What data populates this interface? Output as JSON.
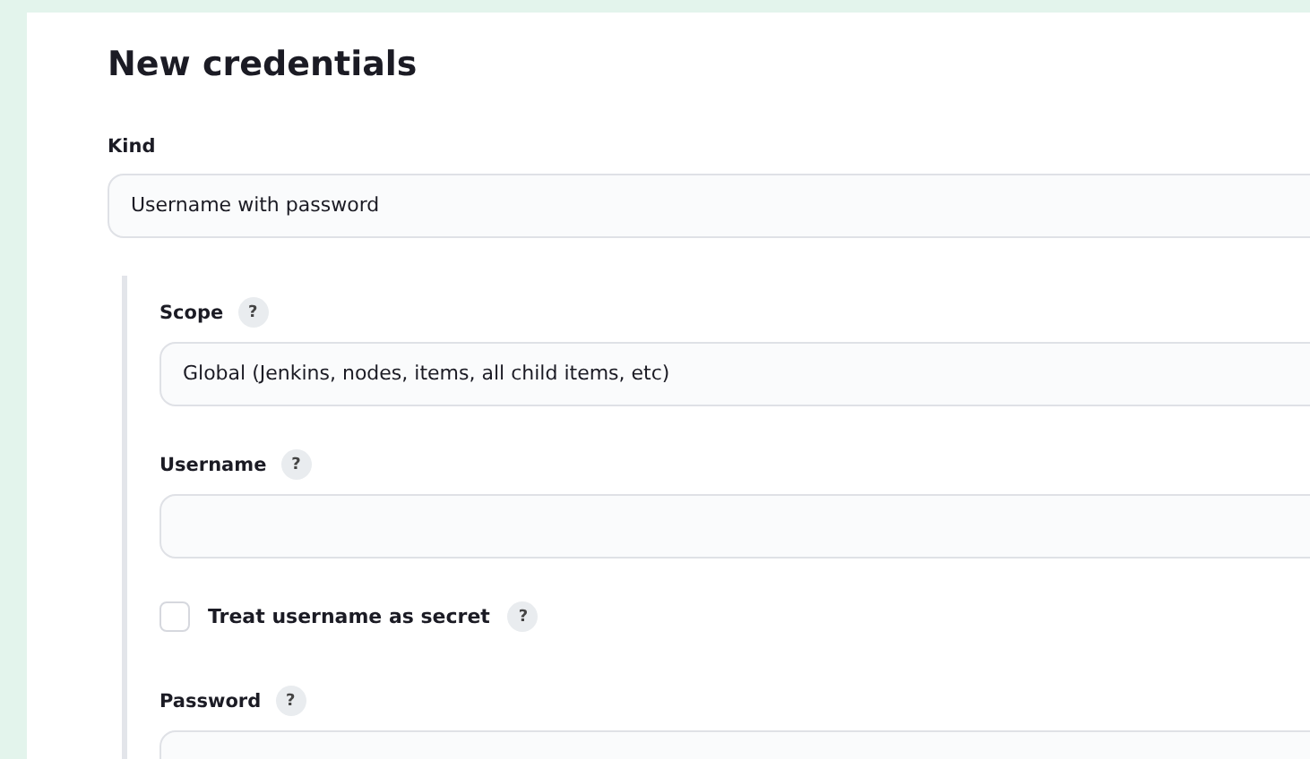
{
  "title": "New credentials",
  "kind": {
    "label": "Kind",
    "value": "Username with password"
  },
  "fields": [
    {
      "kind": "select",
      "label": "Scope",
      "help": "?",
      "value": "Global (Jenkins, nodes, items, all child items, etc)"
    },
    {
      "kind": "text",
      "label": "Username",
      "help": "?"
    },
    {
      "kind": "checkbox",
      "label": "Treat username as secret",
      "help": "?",
      "checked": false
    },
    {
      "kind": "password",
      "label": "Password",
      "help": "?"
    }
  ]
}
